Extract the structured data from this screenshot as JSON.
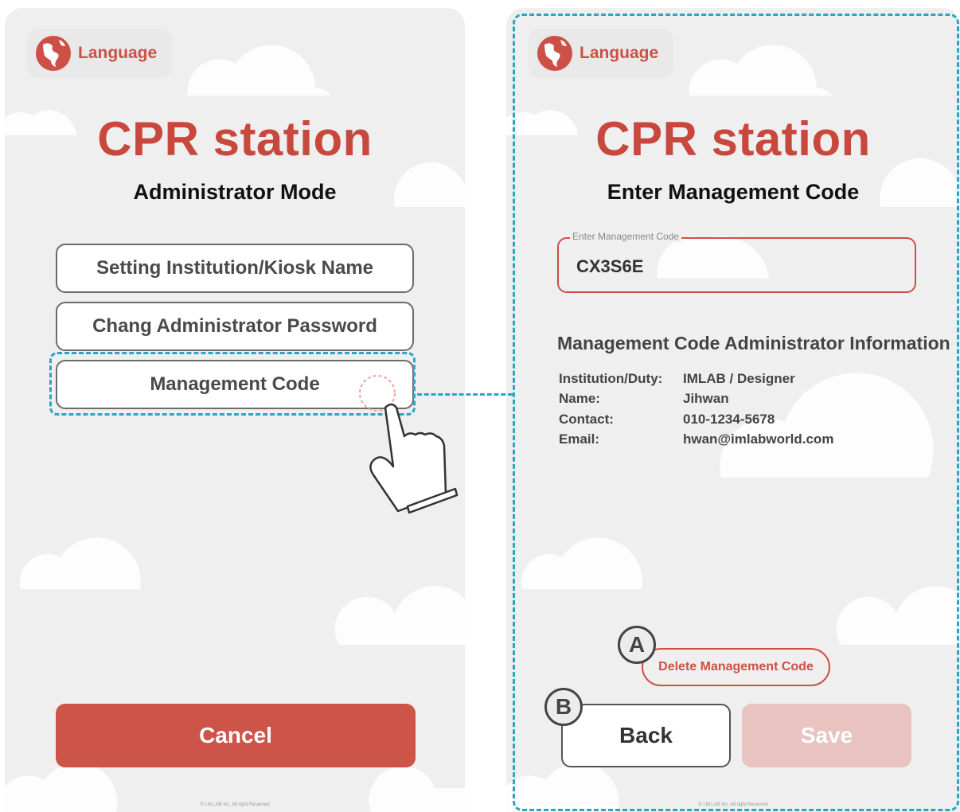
{
  "left_screen": {
    "language_label": "Language",
    "title": "CPR station",
    "subtitle": "Administrator Mode",
    "menu": [
      {
        "label": "Setting Institution/Kiosk Name"
      },
      {
        "label": "Chang Administrator Password"
      },
      {
        "label": "Management Code"
      }
    ],
    "cancel_label": "Cancel",
    "footer": "© I.M.LAB Inc. All right Reserved"
  },
  "right_screen": {
    "language_label": "Language",
    "title": "CPR station",
    "subtitle": "Enter Management Code",
    "code_field": {
      "legend": "Enter Management Code",
      "value": "CX3S6E"
    },
    "info": {
      "title": "Management Code Administrator Information",
      "rows": [
        {
          "key": "Institution/Duty:",
          "value": "IMLAB / Designer"
        },
        {
          "key": "Name:",
          "value": "Jihwan"
        },
        {
          "key": "Contact:",
          "value": "010-1234-5678"
        },
        {
          "key": "Email:",
          "value": "hwan@imlabworld.com"
        }
      ]
    },
    "delete_label": "Delete Management Code",
    "back_label": "Back",
    "save_label": "Save",
    "footer": "© I.M.LAB Inc. All right Reserved"
  },
  "annotations": {
    "marker_a": "A",
    "marker_b": "B"
  },
  "colors": {
    "brand_red": "#cd5047",
    "highlight_blue": "#2aa5c4",
    "save_disabled": "#e9c3bf"
  },
  "icons": {
    "language": "globe-icon",
    "hand": "pointing-hand-icon"
  }
}
